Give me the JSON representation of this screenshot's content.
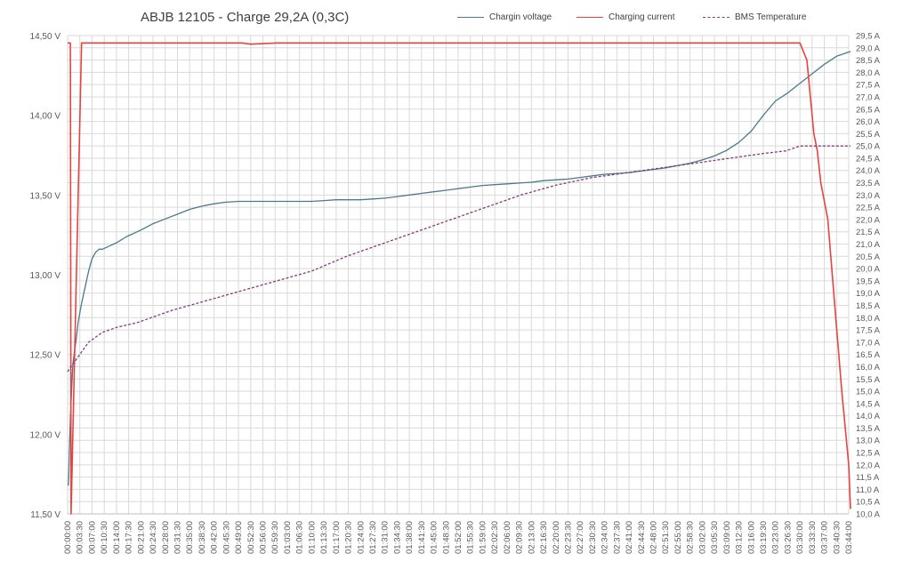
{
  "chart_data": {
    "type": "line",
    "title": "ABJB 12105 - Charge 29,2A  (0,3C)",
    "xlabel": "",
    "ylabel": "",
    "y2label": "",
    "grid": true,
    "legend_position": "top-right",
    "y_left": {
      "unit": "V",
      "range": [
        11.5,
        14.5
      ],
      "ticks": [
        "11,50 V",
        "12,00 V",
        "12,50 V",
        "13,00 V",
        "13,50 V",
        "14,00 V",
        "14,50 V"
      ]
    },
    "y_right": {
      "unit": "A",
      "range": [
        10.0,
        29.5
      ],
      "ticks": [
        "10,0 A",
        "10,5 A",
        "11,0 A",
        "11,5 A",
        "12,0 A",
        "12,5 A",
        "13,0 A",
        "13,5 A",
        "14,0 A",
        "14,5 A",
        "15,0 A",
        "15,5 A",
        "16,0 A",
        "16,5 A",
        "17,0 A",
        "17,5 A",
        "18,0 A",
        "18,5 A",
        "19,0 A",
        "19,5 A",
        "20,0 A",
        "20,5 A",
        "21,0 A",
        "21,5 A",
        "22,0 A",
        "22,5 A",
        "23,0 A",
        "23,5 A",
        "24,0 A",
        "24,5 A",
        "25,0 A",
        "25,5 A",
        "26,0 A",
        "26,5 A",
        "27,0 A",
        "27,5 A",
        "28,0 A",
        "28,5 A",
        "29,0 A",
        "29,5 A"
      ]
    },
    "x_ticks": [
      "00:00:00",
      "00:03:30",
      "00:07:00",
      "00:10:30",
      "00:14:00",
      "00:17:30",
      "00:21:00",
      "00:24:30",
      "00:28:00",
      "00:31:30",
      "00:35:00",
      "00:38:30",
      "00:42:00",
      "00:45:30",
      "00:49:00",
      "00:52:30",
      "00:56:00",
      "00:59:30",
      "01:03:00",
      "01:06:30",
      "01:10:00",
      "01:13:30",
      "01:17:00",
      "01:20:30",
      "01:24:00",
      "01:27:30",
      "01:31:00",
      "01:34:30",
      "01:38:00",
      "01:41:30",
      "01:45:00",
      "01:48:30",
      "01:52:00",
      "01:55:30",
      "01:59:00",
      "02:02:30",
      "02:06:00",
      "02:09:30",
      "02:13:00",
      "02:16:30",
      "02:20:00",
      "02:23:30",
      "02:27:00",
      "02:30:30",
      "02:34:00",
      "02:37:30",
      "02:41:00",
      "02:44:30",
      "02:48:00",
      "02:51:30",
      "02:55:00",
      "02:58:30",
      "03:02:00",
      "03:05:30",
      "03:09:00",
      "03:12:30",
      "03:16:00",
      "03:19:30",
      "03:23:00",
      "03:26:30",
      "03:30:00",
      "03:33:30",
      "03:37:00",
      "03:40:30",
      "03:44:00"
    ],
    "series": [
      {
        "name": "Chargin voltage",
        "axis": "left",
        "color": "#4a7a8c",
        "style": "solid",
        "x": [
          0,
          0.2,
          0.3,
          0.5,
          0.8,
          1.2,
          1.5,
          2,
          2.5,
          3,
          4,
          5,
          6,
          7,
          8,
          9,
          10,
          12,
          14,
          17,
          21,
          24.5,
          28,
          31.5,
          35,
          38.5,
          42,
          45.5,
          49,
          52.5,
          56,
          59.5,
          63,
          66.5,
          70,
          73.5,
          77,
          80.5,
          84,
          87.5,
          91,
          94.5,
          98,
          101.5,
          105,
          108.5,
          112,
          115.5,
          119,
          122.5,
          126,
          129.5,
          133,
          136.5,
          140,
          143.5,
          147,
          150.5,
          154,
          157.5,
          161,
          164.5,
          168,
          171.5,
          175,
          178.5,
          182,
          185.5,
          189,
          192.5,
          196,
          199.5,
          203,
          206.5,
          210,
          213.5,
          217,
          220.5,
          224.5
        ],
        "values": [
          11.68,
          11.68,
          11.72,
          11.9,
          12.1,
          12.3,
          12.44,
          12.52,
          12.6,
          12.7,
          12.82,
          12.92,
          13.02,
          13.1,
          13.14,
          13.16,
          13.16,
          13.18,
          13.2,
          13.24,
          13.28,
          13.32,
          13.35,
          13.38,
          13.41,
          13.43,
          13.445,
          13.455,
          13.46,
          13.46,
          13.46,
          13.46,
          13.46,
          13.46,
          13.46,
          13.465,
          13.47,
          13.47,
          13.47,
          13.475,
          13.48,
          13.49,
          13.5,
          13.51,
          13.52,
          13.53,
          13.54,
          13.55,
          13.56,
          13.565,
          13.57,
          13.575,
          13.58,
          13.59,
          13.595,
          13.6,
          13.61,
          13.62,
          13.63,
          13.635,
          13.64,
          13.65,
          13.66,
          13.67,
          13.685,
          13.7,
          13.72,
          13.745,
          13.78,
          13.83,
          13.9,
          14.0,
          14.09,
          14.14,
          14.2,
          14.26,
          14.32,
          14.37,
          14.4
        ]
      },
      {
        "name": "Charging current",
        "axis": "right",
        "color": "#e8433f",
        "style": "solid",
        "x": [
          0,
          0.8,
          1,
          4,
          12,
          30,
          50,
          52.5,
          60,
          120,
          180,
          210,
          212,
          213,
          214,
          215,
          216,
          218,
          220,
          222,
          224,
          224.5
        ],
        "values": [
          29.2,
          29.2,
          10.0,
          29.2,
          29.2,
          29.2,
          29.2,
          29.15,
          29.2,
          29.2,
          29.2,
          29.2,
          28.5,
          27.0,
          25.5,
          24.8,
          23.5,
          22.0,
          18.5,
          15.0,
          12.0,
          10.2
        ]
      },
      {
        "name": "BMS Temperature",
        "axis": "right",
        "color": "#8a3a78",
        "style": "dashed",
        "x": [
          0,
          3,
          6,
          10,
          14,
          20,
          30,
          40,
          50,
          60,
          70,
          80,
          90,
          100,
          110,
          120,
          130,
          140,
          150,
          160,
          170,
          180,
          190,
          200,
          206,
          210,
          215,
          220,
          224.5
        ],
        "values": [
          15.8,
          16.4,
          17.0,
          17.4,
          17.6,
          17.8,
          18.3,
          18.7,
          19.1,
          19.5,
          19.9,
          20.5,
          21.0,
          21.5,
          22.0,
          22.5,
          23.0,
          23.4,
          23.7,
          23.9,
          24.1,
          24.3,
          24.5,
          24.7,
          24.8,
          25.0,
          25.0,
          25.0,
          25.0
        ]
      }
    ]
  }
}
